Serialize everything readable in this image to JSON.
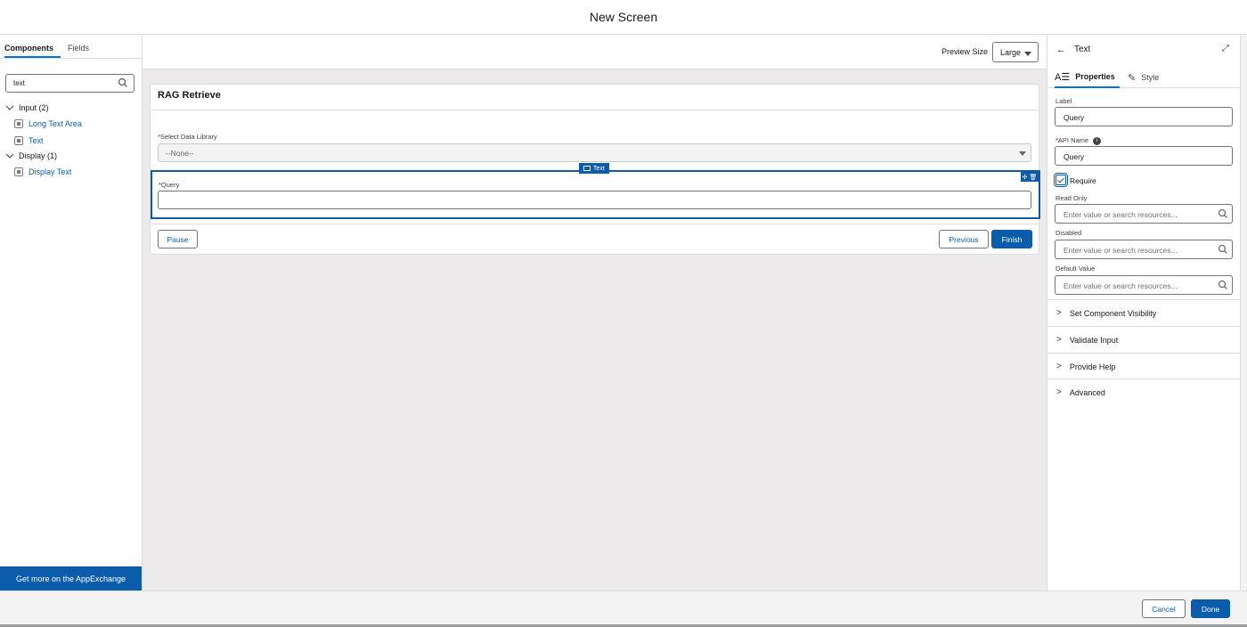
{
  "header": {
    "title": "New Screen"
  },
  "left_panel": {
    "tabs": [
      {
        "label": "Components"
      },
      {
        "label": "Fields"
      }
    ],
    "search": {
      "value": "text"
    },
    "groups": [
      {
        "label": "Input (2)",
        "items": [
          "Long Text Area",
          "Text"
        ]
      },
      {
        "label": "Display (1)",
        "items": [
          "Display Text"
        ]
      }
    ],
    "appexchange_label": "Get more on the AppExchange"
  },
  "canvas": {
    "preview_size_label": "Preview Size",
    "preview_size_value": "Large",
    "screen_title": "RAG Retrieve",
    "select_field": {
      "label": "Select Data Library",
      "value": "--None--"
    },
    "selected_tag": "Text",
    "query_field": {
      "label": "Query"
    },
    "buttons": {
      "pause": "Pause",
      "previous": "Previous",
      "finish": "Finish"
    }
  },
  "properties_panel": {
    "back_icon": "arrow-left-icon",
    "title": "Text",
    "tabs": [
      {
        "label": "Properties",
        "icon": "properties-icon"
      },
      {
        "label": "Style",
        "icon": "brush-icon"
      }
    ],
    "label_field": {
      "label": "Label",
      "value": "Query"
    },
    "api_name_field": {
      "label": "API Name",
      "value": "Query"
    },
    "require": {
      "label": "Require",
      "checked": true
    },
    "read_only": {
      "label": "Read Only",
      "placeholder": "Enter value or search resources..."
    },
    "disabled": {
      "label": "Disabled",
      "placeholder": "Enter value or search resources..."
    },
    "default_value": {
      "label": "Default Value",
      "placeholder": "Enter value or search resources..."
    },
    "sections": [
      "Set Component Visibility",
      "Validate Input",
      "Provide Help",
      "Advanced"
    ]
  },
  "footer": {
    "cancel": "Cancel",
    "done": "Done"
  },
  "colors": {
    "brand": "#0b5cab",
    "border": "#dddbda",
    "canvas_bg": "#eceaea"
  }
}
